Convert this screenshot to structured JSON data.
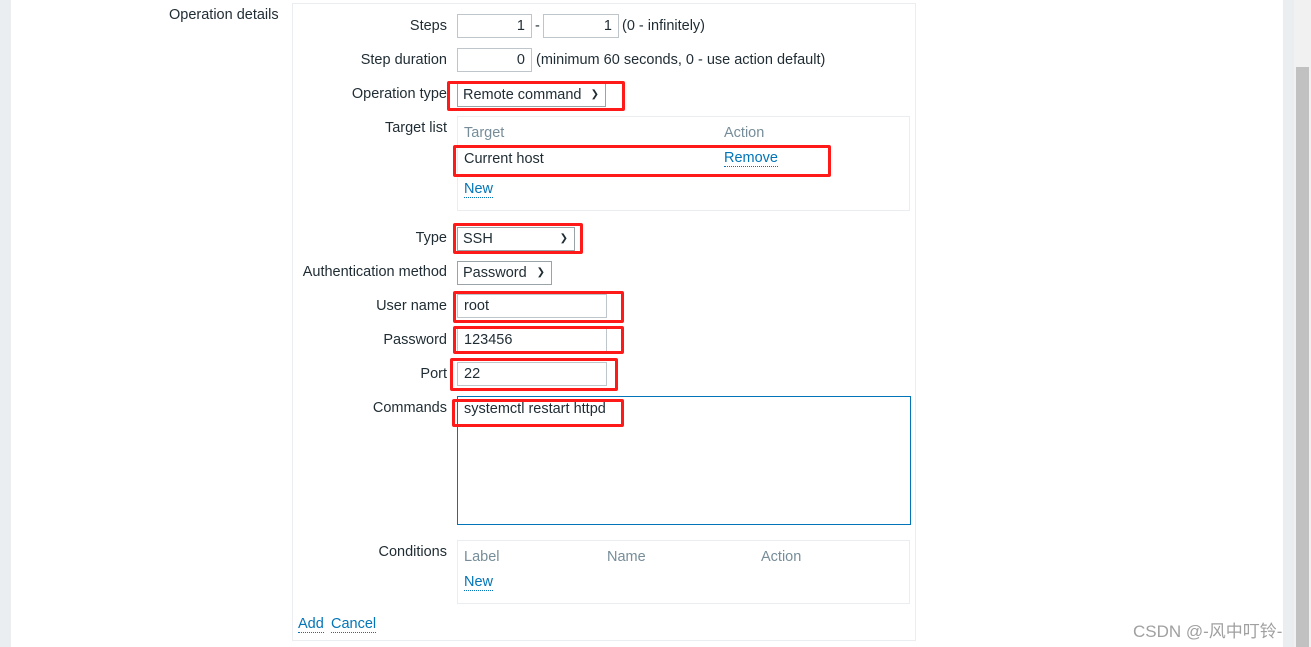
{
  "section_label": "Operation details",
  "steps": {
    "label": "Steps",
    "from": "1",
    "to": "1",
    "separator": "-",
    "hint": "(0 - infinitely)"
  },
  "step_duration": {
    "label": "Step duration",
    "value": "0",
    "hint": "(minimum 60 seconds, 0 - use action default)"
  },
  "operation_type": {
    "label": "Operation type",
    "value": "Remote command"
  },
  "target_list": {
    "label": "Target list",
    "col_target": "Target",
    "col_action": "Action",
    "rows": [
      {
        "target": "Current host",
        "action": "Remove"
      }
    ],
    "new_label": "New"
  },
  "type": {
    "label": "Type",
    "value": "SSH"
  },
  "auth_method": {
    "label": "Authentication method",
    "value": "Password"
  },
  "user_name": {
    "label": "User name",
    "value": "root"
  },
  "password": {
    "label": "Password",
    "value": "123456"
  },
  "port": {
    "label": "Port",
    "value": "22"
  },
  "commands": {
    "label": "Commands",
    "value": "systemctl restart httpd"
  },
  "conditions": {
    "label": "Conditions",
    "col_label": "Label",
    "col_name": "Name",
    "col_action": "Action",
    "new_label": "New"
  },
  "actions": {
    "add": "Add",
    "cancel": "Cancel"
  },
  "watermark": "CSDN @-风中叮铃-",
  "colors": {
    "link": "#0275b8",
    "highlight": "#ff1a1a"
  }
}
